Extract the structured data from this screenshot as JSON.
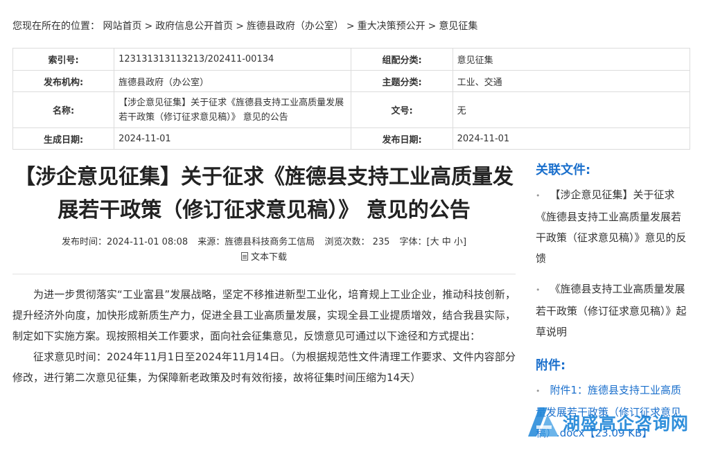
{
  "breadcrumb": {
    "prefix": "您现在所在的位置：",
    "items": [
      "网站首页",
      "政府信息公开首页",
      "旌德县政府（办公室）",
      "重大决策预公开",
      "意见征集"
    ],
    "separator": ">"
  },
  "meta_table": {
    "index_label": "索引号:",
    "index_value": "123131313113213/202411-00134",
    "category_label": "组配分类:",
    "category_value": "意见征集",
    "publisher_label": "发布机构:",
    "publisher_value": "旌德县政府（办公室）",
    "topic_label": "主题分类:",
    "topic_value": "工业、交通",
    "name_label": "名称:",
    "name_value": "【涉企意见征集】关于征求《旌德县支持工业高质量发展若干政策（修订征求意见稿）》 意见的公告",
    "docno_label": "文号:",
    "docno_value": "无",
    "created_label": "生成日期:",
    "created_value": "2024-11-01",
    "published_label": "发布日期:",
    "published_value": "2024-11-01"
  },
  "article": {
    "title": "【涉企意见征集】关于征求《旌德县支持工业高质量发展若干政策（修订征求意见稿）》 意见的公告",
    "publish_time": "发布时间：2024-11-01 08:08",
    "source": "来源：旌德县科技商务工信局",
    "views": "浏览次数：  235",
    "font_size_label": "字体：[",
    "font_large": "大",
    "font_medium": "中",
    "font_small": "小",
    "font_size_end": "]",
    "download_label": "文本下载",
    "paragraphs": [
      "为进一步贯彻落实“工业富县”发展战略，坚定不移推进新型工业化，培育规上工业企业，推动科技创新，提升经济外向度，加快形成新质生产力，促进全县工业高质量发展，实现全县工业提质增效，结合我县实际，制定如下实施方案。现按照相关工作要求，面向社会征集意见，反馈意见可通过以下途径和方式提出：",
      "征求意见时间：2024年11月1日至2024年11月14日。（为根据规范性文件清理工作要求、文件内容部分修改，进行第二次意见征集，为保障新老政策及时有效衔接，故将征集时间压缩为14天）"
    ]
  },
  "sidebar": {
    "related_title": "关联文件:",
    "related_items": [
      "【涉企意见征集】关于征求《旌德县支持工业高质量发展若干政策（征求意见稿）》意见的反馈",
      "《旌德县支持工业高质量发展若干政策（修订征求意见稿）》起草说明"
    ],
    "attachment_title": "附件:",
    "attachment_items": [
      "附件1：旌德县支持工业高质量发展若干政策（修订征求意见稿）.docx【23.09 KB】"
    ]
  },
  "watermark": {
    "text": "湖盛高企咨询网",
    "color": "#1f86d8"
  },
  "colors": {
    "accent": "#1a6fcc",
    "text": "#333333",
    "border": "#dcdcdc"
  }
}
